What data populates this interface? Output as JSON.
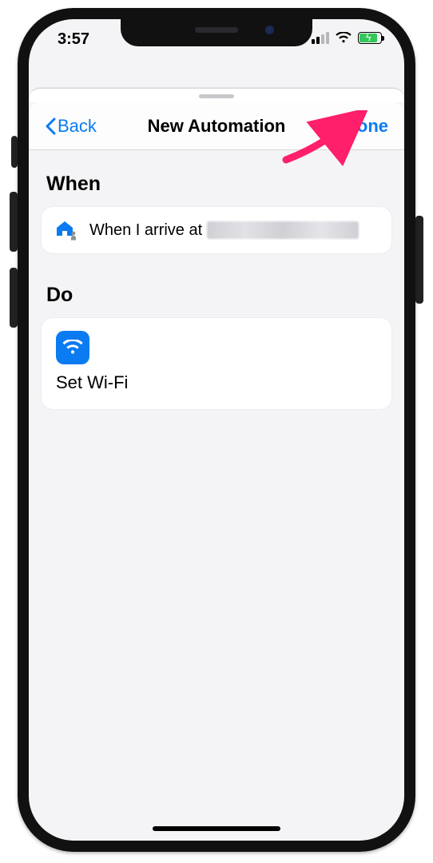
{
  "status": {
    "time": "3:57",
    "signal_bars": 2
  },
  "nav": {
    "back": "Back",
    "title": "New Automation",
    "done": "Done"
  },
  "sections": {
    "when": {
      "heading": "When",
      "prefix": "When I arrive at",
      "location_obscured": true
    },
    "do": {
      "heading": "Do",
      "action_label": "Set Wi-Fi"
    }
  },
  "annotation": {
    "target": "done-button"
  },
  "colors": {
    "accent": "#0b7bf1",
    "battery_fill": "#34c759"
  }
}
